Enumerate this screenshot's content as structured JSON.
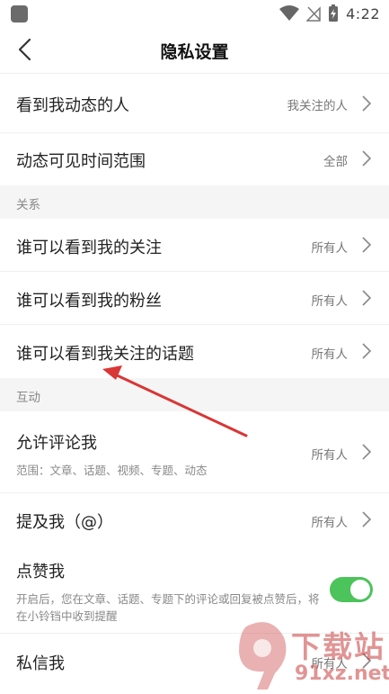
{
  "status_bar": {
    "time": "4:22"
  },
  "header": {
    "title": "隐私设置"
  },
  "rows": {
    "dynamic_viewers": {
      "label": "看到我动态的人",
      "value": "我关注的人"
    },
    "dynamic_time_range": {
      "label": "动态可见时间范围",
      "value": "全部"
    },
    "who_see_follows": {
      "label": "谁可以看到我的关注",
      "value": "所有人"
    },
    "who_see_fans": {
      "label": "谁可以看到我的粉丝",
      "value": "所有人"
    },
    "who_see_topics": {
      "label": "谁可以看到我关注的话题",
      "value": "所有人"
    },
    "allow_comment": {
      "label": "允许评论我",
      "value": "所有人",
      "desc": "范围：文章、话题、视频、专题、动态"
    },
    "mention_me": {
      "label": "提及我（@）",
      "value": "所有人"
    },
    "like_me": {
      "label": "点赞我",
      "desc": "开启后，您在文章、话题、专题下的评论或回复被点赞后，将在小铃铛中收到提醒",
      "enabled": true
    },
    "private_message": {
      "label": "私信我",
      "value": "所有人"
    }
  },
  "sections": {
    "relations": "关系",
    "interaction": "互动"
  },
  "watermark": {
    "text": "下载站",
    "url": "91xz.net"
  },
  "colors": {
    "toggle_on": "#4cc35b",
    "annotation_arrow": "#d93636",
    "section_bg": "#f5f5f5"
  },
  "icons": {
    "back": "chevron-left-icon",
    "row_arrow": "chevron-right-icon"
  }
}
